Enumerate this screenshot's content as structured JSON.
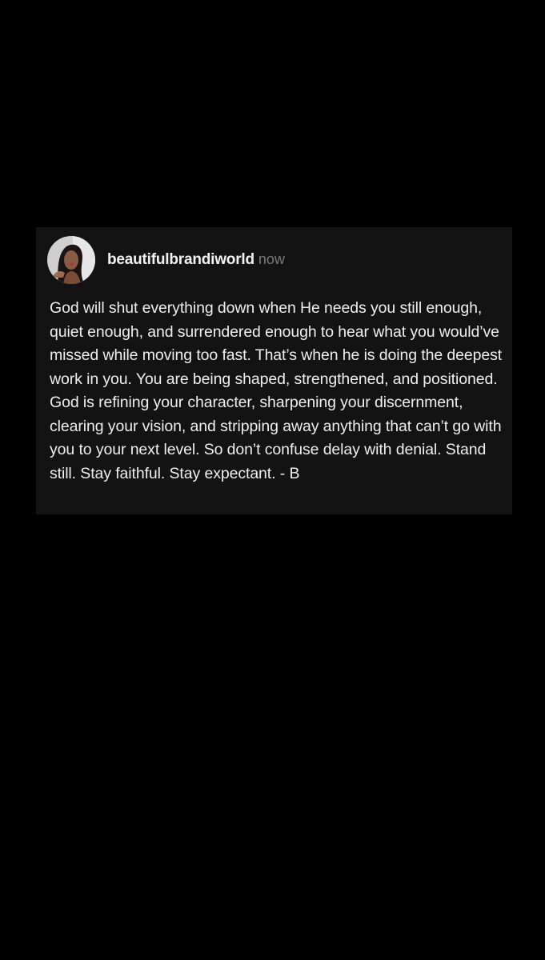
{
  "post": {
    "username": "beautifulbrandiworld",
    "timestamp": "now",
    "avatar_icon": "profile-photo",
    "body": "God will shut everything down when He needs you still enough, quiet enough, and surrendered enough to hear what you would’ve missed while moving too fast. That’s when he is doing the deepest work in you. You are being shaped, strengthened, and positioned. God is refining your character, sharpening your discernment, clearing your vision, and stripping away anything that can’t go with you to your next level. So don’t confuse delay with denial. Stand still. Stay faithful. Stay expectant. - B"
  },
  "colors": {
    "background": "#000000",
    "card": "#131313",
    "username": "#f2f2f2",
    "timestamp": "#7a7a7a",
    "body_text": "#eeeeee"
  }
}
